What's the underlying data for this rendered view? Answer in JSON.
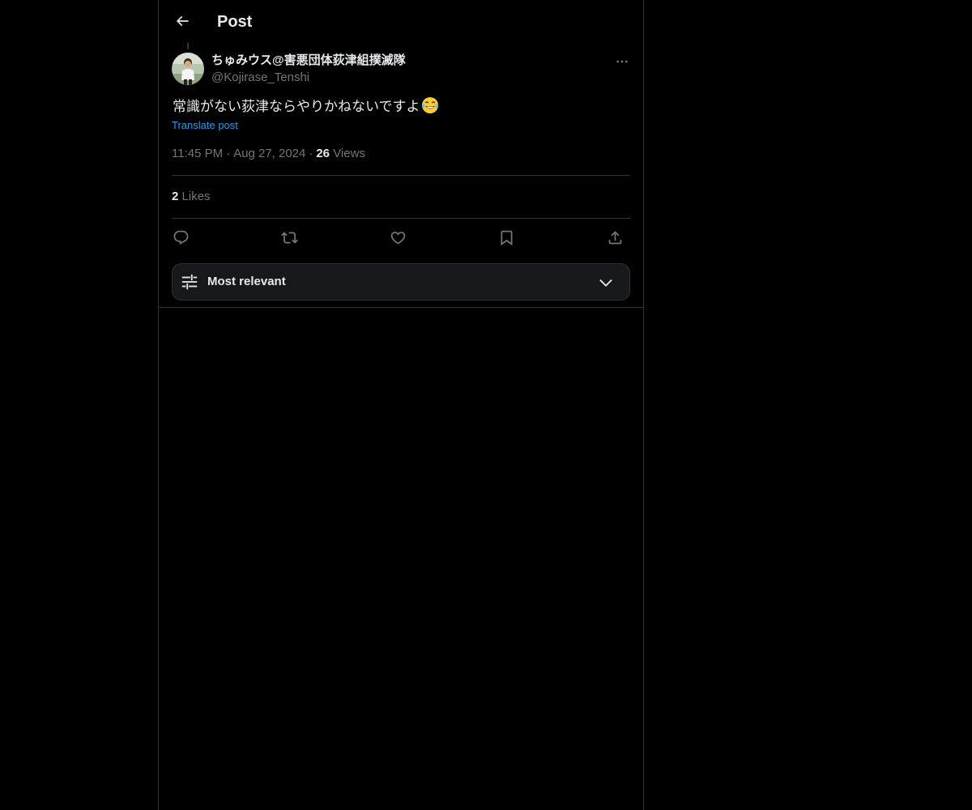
{
  "header": {
    "back_icon": "arrow-left-icon",
    "title": "Post"
  },
  "post": {
    "author": {
      "display_name": "ちゅみウス@害悪団体荻津組撲滅隊",
      "handle": "@Kojirase_Tenshi",
      "avatar_icon": "avatar-photo"
    },
    "text": "常識がない荻津ならやりかねないですよ",
    "emoji_icon": "face-with-tears-of-joy-icon",
    "translate_label": "Translate post",
    "time": "11:45 PM",
    "separator": "·",
    "date": "Aug 27, 2024",
    "views_count": "26",
    "views_label": "Views",
    "likes_count": "2",
    "likes_label": "Likes"
  },
  "actions": {
    "reply_icon": "reply-icon",
    "repost_icon": "repost-icon",
    "like_icon": "heart-icon",
    "bookmark_icon": "bookmark-icon",
    "share_icon": "share-icon"
  },
  "sort": {
    "label": "Most relevant",
    "icon": "sliders-icon",
    "chevron": "chevron-down-icon"
  },
  "colors": {
    "background": "#000000",
    "text_primary": "#e7e9ea",
    "text_secondary": "#71767b",
    "link": "#1d9bf0",
    "border": "#2f3336",
    "sort_bg": "#16181c"
  }
}
